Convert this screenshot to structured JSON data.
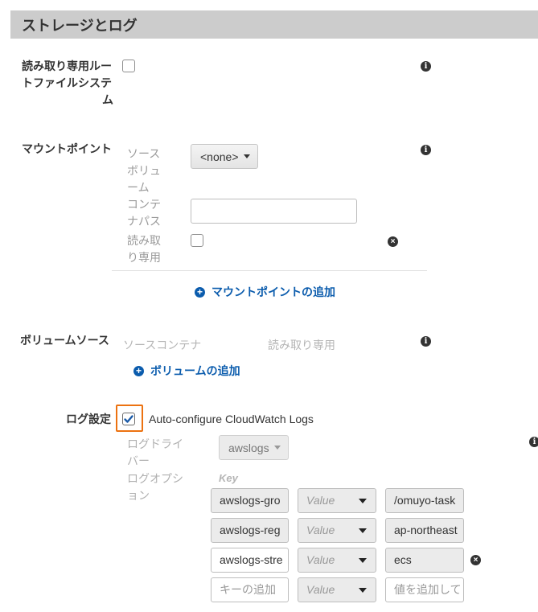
{
  "section": {
    "title": "ストレージとログ"
  },
  "readonly_root": {
    "label_lines": [
      "読み取り専用ルー",
      "トファイルシステ",
      "ム"
    ]
  },
  "mount_points": {
    "label": "マウントポイント",
    "source_volume_lines": [
      "ソース",
      "ボリュ",
      "ーム"
    ],
    "source_volume_value": "<none>",
    "container_path_lines": [
      "コンテ",
      "ナパス"
    ],
    "container_path_value": "",
    "readonly_lines": [
      "読み取",
      "り専用"
    ],
    "add_label": "マウントポイントの追加"
  },
  "volumes_from": {
    "label": "ボリュームソース",
    "col_source": "ソースコンテナ",
    "col_readonly": "読み取り専用",
    "add_label": "ボリュームの追加"
  },
  "log": {
    "label": "ログ設定",
    "auto_configure_label": "Auto-configure CloudWatch Logs",
    "auto_configure_checked": true,
    "driver_lines": [
      "ログドライ",
      "バー"
    ],
    "driver_value": "awslogs",
    "options_lines": [
      "ログオプシ",
      "ョン"
    ],
    "key_header": "Key",
    "rows": [
      {
        "key": "awslogs-gro",
        "value_type": "Value",
        "value": "/omuyo-task"
      },
      {
        "key": "awslogs-reg",
        "value_type": "Value",
        "value": "ap-northeast"
      },
      {
        "key": "awslogs-stre",
        "value_type": "Value",
        "value": "ecs"
      }
    ],
    "new_row": {
      "key_placeholder": "キーの追加",
      "value_type": "Value",
      "value_placeholder": "値を追加して"
    }
  },
  "icons": {
    "info": "info-icon",
    "remove": "remove-icon",
    "add": "plus-circle-icon",
    "check": "check-icon"
  }
}
